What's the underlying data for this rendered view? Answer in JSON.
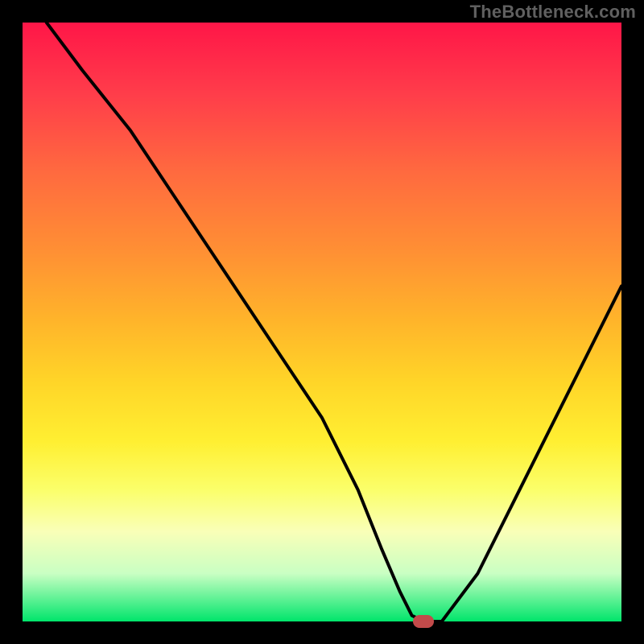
{
  "watermark": "TheBottleneck.com",
  "chart_data": {
    "type": "line",
    "title": "",
    "xlabel": "",
    "ylabel": "",
    "xlim": [
      0,
      100
    ],
    "ylim": [
      0,
      100
    ],
    "series": [
      {
        "name": "bottleneck-curve",
        "x": [
          4,
          10,
          18,
          26,
          34,
          42,
          50,
          56,
          60,
          63,
          65,
          67,
          70,
          76,
          82,
          88,
          94,
          100
        ],
        "y": [
          100,
          92,
          82,
          70,
          58,
          46,
          34,
          22,
          12,
          5,
          1,
          0,
          0,
          8,
          20,
          32,
          44,
          56
        ]
      }
    ],
    "marker": {
      "x": 67,
      "y": 0
    },
    "gradient_stops": [
      {
        "pct": 0,
        "color": "#ff1648"
      },
      {
        "pct": 12,
        "color": "#ff3d4a"
      },
      {
        "pct": 25,
        "color": "#ff6a3f"
      },
      {
        "pct": 38,
        "color": "#ff8f34"
      },
      {
        "pct": 50,
        "color": "#ffb52a"
      },
      {
        "pct": 60,
        "color": "#ffd528"
      },
      {
        "pct": 70,
        "color": "#ffef32"
      },
      {
        "pct": 78,
        "color": "#fbff6a"
      },
      {
        "pct": 85,
        "color": "#f9ffb8"
      },
      {
        "pct": 92,
        "color": "#c9ffc3"
      },
      {
        "pct": 100,
        "color": "#00e56b"
      }
    ]
  }
}
